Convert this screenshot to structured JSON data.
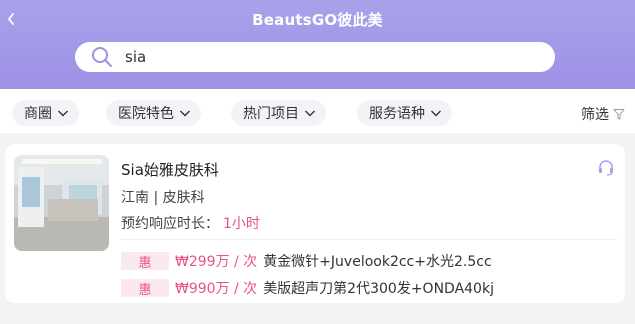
{
  "header": {
    "title": "BeautsGO彼此美"
  },
  "search": {
    "value": "sia"
  },
  "filters": [
    {
      "label": "商圈"
    },
    {
      "label": "医院特色"
    },
    {
      "label": "热门项目"
    },
    {
      "label": "服务语种"
    }
  ],
  "screen_label": "筛选",
  "clinic": {
    "name": "Sia始雅皮肤科",
    "meta": "江南 |  皮肤科",
    "response_label": "预约响应时长：",
    "response_value": "1小时",
    "deals": [
      {
        "badge": "惠",
        "price": "₩299万 / 次",
        "desc": "黄金微针+Juvelook2cc+水光2.5cc"
      },
      {
        "badge": "惠",
        "price": "₩990万 / 次",
        "desc": "美版超声刀第2代300发+ONDA40kj"
      }
    ]
  },
  "colors": {
    "header": "#a8a2ea",
    "accent": "#e5548a",
    "badge_bg": "#fce9f0"
  }
}
